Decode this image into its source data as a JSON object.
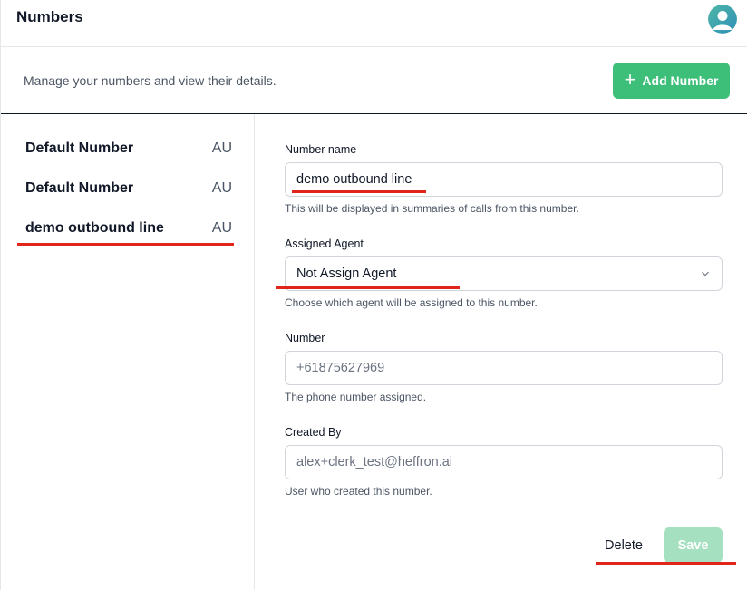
{
  "header": {
    "title": "Numbers",
    "avatar_icon": "user-avatar-icon"
  },
  "subheader": {
    "description": "Manage your numbers and view their details.",
    "add_button_label": "Add Number",
    "add_button_icon": "plus-icon"
  },
  "numbers_list": [
    {
      "name": "Default Number",
      "country": "AU"
    },
    {
      "name": "Default Number",
      "country": "AU"
    },
    {
      "name": "demo outbound line",
      "country": "AU"
    }
  ],
  "form": {
    "number_name": {
      "label": "Number name",
      "value": "demo outbound line",
      "help": "This will be displayed in summaries of calls from this number."
    },
    "assigned_agent": {
      "label": "Assigned Agent",
      "value": "Not Assign Agent",
      "help": "Choose which agent will be assigned to this number."
    },
    "number": {
      "label": "Number",
      "value": "+61875627969",
      "help": "The phone number assigned."
    },
    "created_by": {
      "label": "Created By",
      "value": "alex+clerk_test@heffron.ai",
      "help": "User who created this number."
    }
  },
  "actions": {
    "delete_label": "Delete",
    "save_label": "Save"
  },
  "colors": {
    "accent": "#3dbf7a",
    "accent_disabled": "#a5e0c0",
    "annotation_red": "#e0251b"
  }
}
